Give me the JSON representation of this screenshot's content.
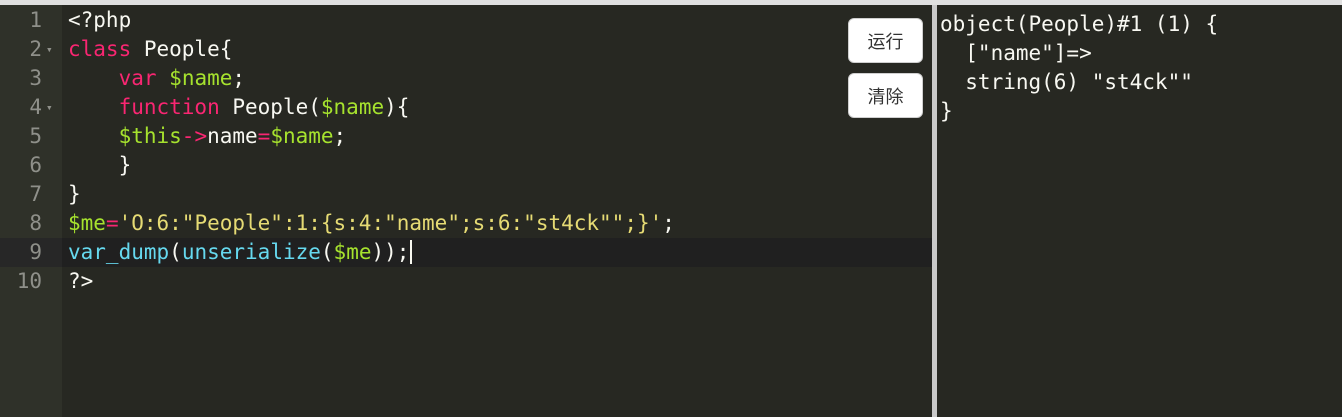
{
  "editor": {
    "lines": [
      {
        "n": "1",
        "fold": "",
        "segs": [
          {
            "t": "<?php",
            "c": "plain"
          }
        ]
      },
      {
        "n": "2",
        "fold": "▾",
        "segs": [
          {
            "t": "class",
            "c": "kw"
          },
          {
            "t": " People{",
            "c": "plain"
          }
        ]
      },
      {
        "n": "3",
        "fold": "",
        "segs": [
          {
            "t": "    ",
            "c": "plain"
          },
          {
            "t": "var",
            "c": "kw"
          },
          {
            "t": " ",
            "c": "plain"
          },
          {
            "t": "$name",
            "c": "var"
          },
          {
            "t": ";",
            "c": "plain"
          }
        ]
      },
      {
        "n": "4",
        "fold": "▾",
        "segs": [
          {
            "t": "    ",
            "c": "plain"
          },
          {
            "t": "function",
            "c": "kw"
          },
          {
            "t": " People(",
            "c": "plain"
          },
          {
            "t": "$name",
            "c": "var"
          },
          {
            "t": "){",
            "c": "plain"
          }
        ]
      },
      {
        "n": "5",
        "fold": "",
        "segs": [
          {
            "t": "    ",
            "c": "plain"
          },
          {
            "t": "$this",
            "c": "var"
          },
          {
            "t": "->",
            "c": "op"
          },
          {
            "t": "name",
            "c": "plain"
          },
          {
            "t": "=",
            "c": "op"
          },
          {
            "t": "$name",
            "c": "var"
          },
          {
            "t": ";",
            "c": "plain"
          }
        ]
      },
      {
        "n": "6",
        "fold": "",
        "segs": [
          {
            "t": "    }",
            "c": "plain"
          }
        ]
      },
      {
        "n": "7",
        "fold": "",
        "segs": [
          {
            "t": "}",
            "c": "plain"
          }
        ]
      },
      {
        "n": "8",
        "fold": "",
        "segs": [
          {
            "t": "$me",
            "c": "var"
          },
          {
            "t": "=",
            "c": "op"
          },
          {
            "t": "'O:6:\"People\":1:{s:4:\"name\";s:6:\"st4ck\"\";}'",
            "c": "str"
          },
          {
            "t": ";",
            "c": "plain"
          }
        ]
      },
      {
        "n": "9",
        "fold": "",
        "active": true,
        "segs": [
          {
            "t": "var_dump",
            "c": "fn"
          },
          {
            "t": "(",
            "c": "plain"
          },
          {
            "t": "unserialize",
            "c": "fn"
          },
          {
            "t": "(",
            "c": "plain"
          },
          {
            "t": "$me",
            "c": "var"
          },
          {
            "t": "));",
            "c": "plain"
          }
        ]
      },
      {
        "n": "10",
        "fold": "",
        "segs": [
          {
            "t": "?>",
            "c": "plain"
          }
        ]
      }
    ]
  },
  "buttons": {
    "run_label": "运行",
    "clear_label": "清除"
  },
  "output": {
    "lines": [
      "object(People)#1 (1) {",
      "  [\"name\"]=>",
      "  string(6) \"st4ck\"\"",
      "}"
    ]
  },
  "colors": {
    "background": "#272822",
    "keyword": "#f92672",
    "variable": "#a6e22e",
    "string": "#e6db74",
    "function": "#66d9ef"
  }
}
